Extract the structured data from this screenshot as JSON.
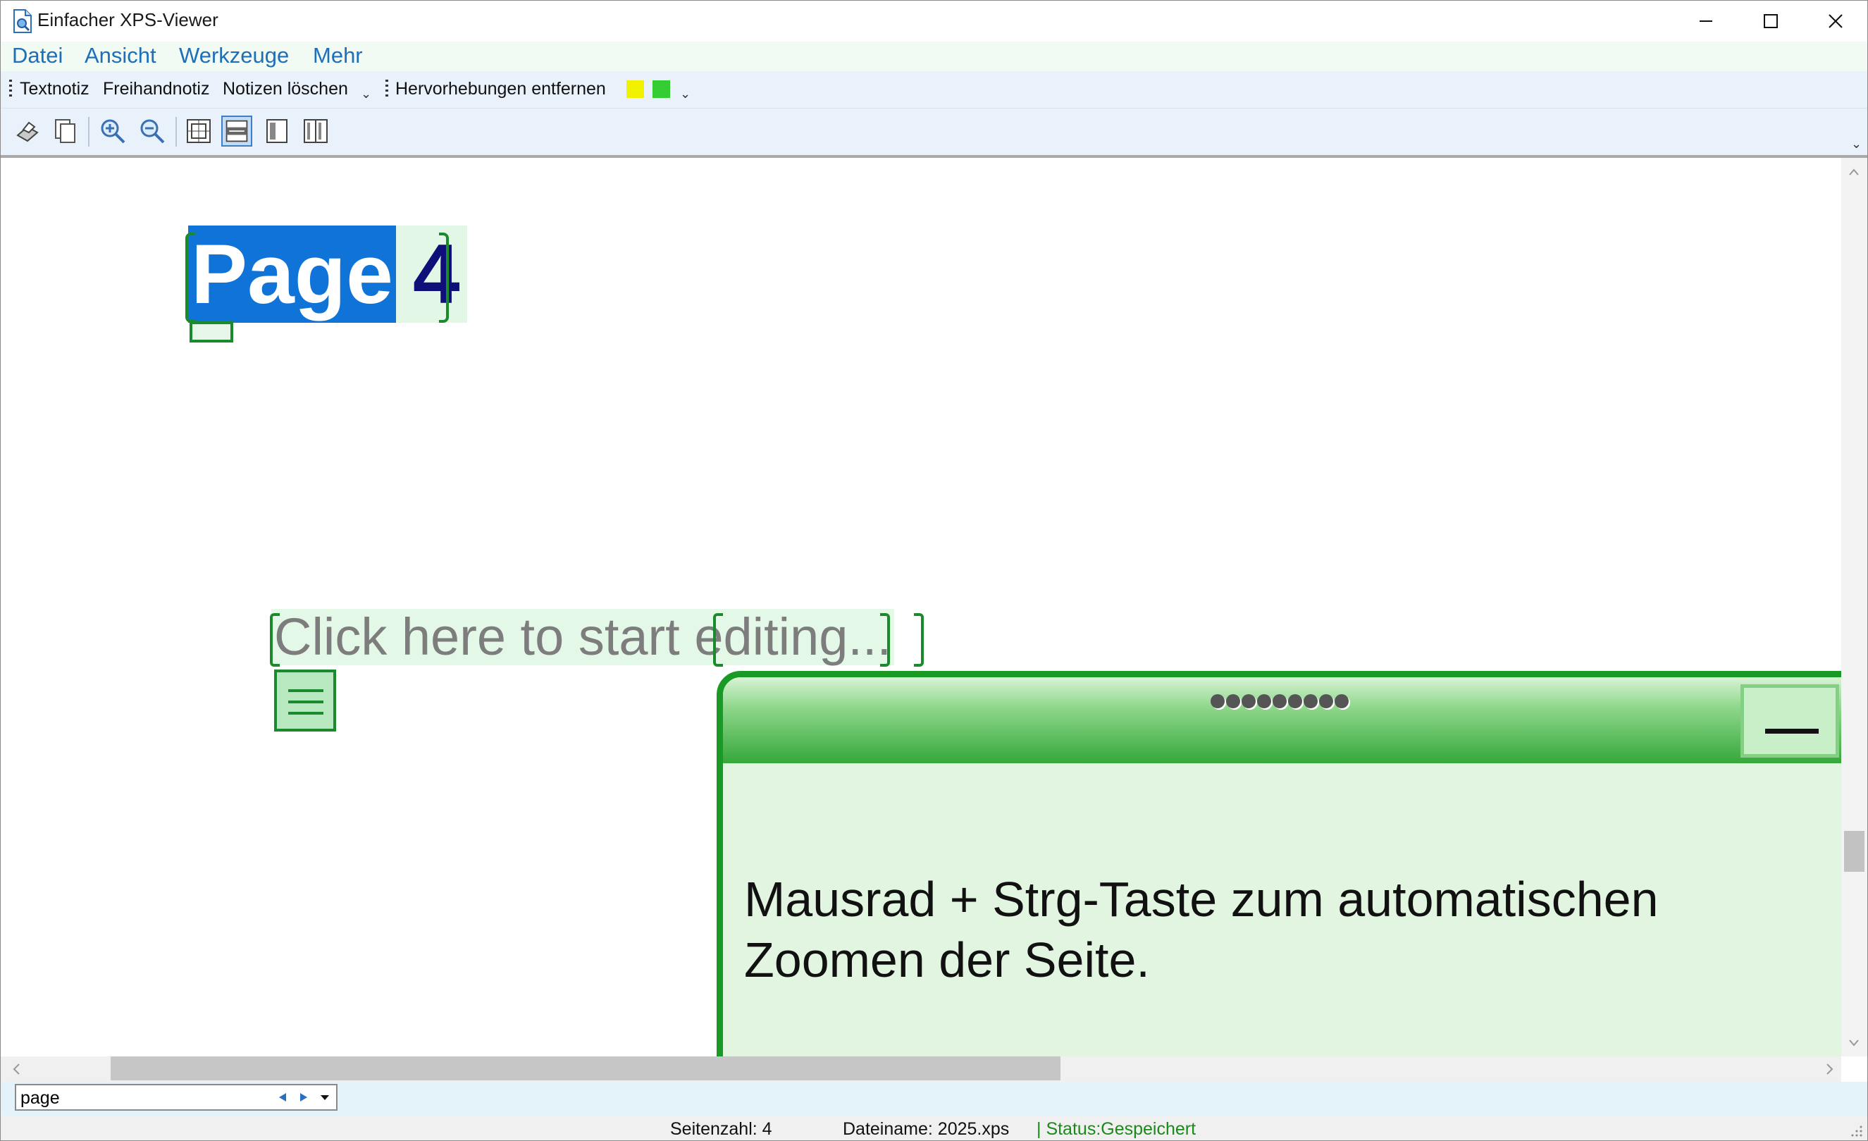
{
  "window": {
    "title": "Einfacher XPS-Viewer"
  },
  "menu": {
    "items": [
      "Datei",
      "Ansicht",
      "Werkzeuge",
      "Mehr"
    ]
  },
  "annotation_toolbar": {
    "text_note": "Textnotiz",
    "freehand_note": "Freihandnotiz",
    "delete_notes": "Notizen löschen",
    "remove_highlights": "Hervorhebungen entfernen",
    "highlight_colors": [
      "#f2f200",
      "#33cc33"
    ]
  },
  "icon_toolbar": {
    "icons": [
      "print-icon",
      "copy-icon",
      "zoom-in-icon",
      "zoom-out-icon",
      "fit-page-icon",
      "fit-width-icon",
      "single-page-icon",
      "two-page-icon"
    ],
    "active": "fit-width-icon"
  },
  "document": {
    "heading_selected": "Page",
    "heading_rest": "4",
    "editable_prefix": "Click here to start ",
    "editable_word": "editing",
    "editable_suffix": "..."
  },
  "notification": {
    "message": "Mausrad + Strg-Taste zum automatischen Zoomen der Seite."
  },
  "search": {
    "value": "page"
  },
  "status": {
    "page_count": "Seitenzahl: 4",
    "filename": "Dateiname: 2025.xps",
    "state": "| Status:Gespeichert"
  },
  "colors": {
    "accent_blue": "#1f6fb8",
    "selection": "#0f73d8",
    "note_green": "#1b8a2c",
    "status_green": "#1a8a1a"
  }
}
